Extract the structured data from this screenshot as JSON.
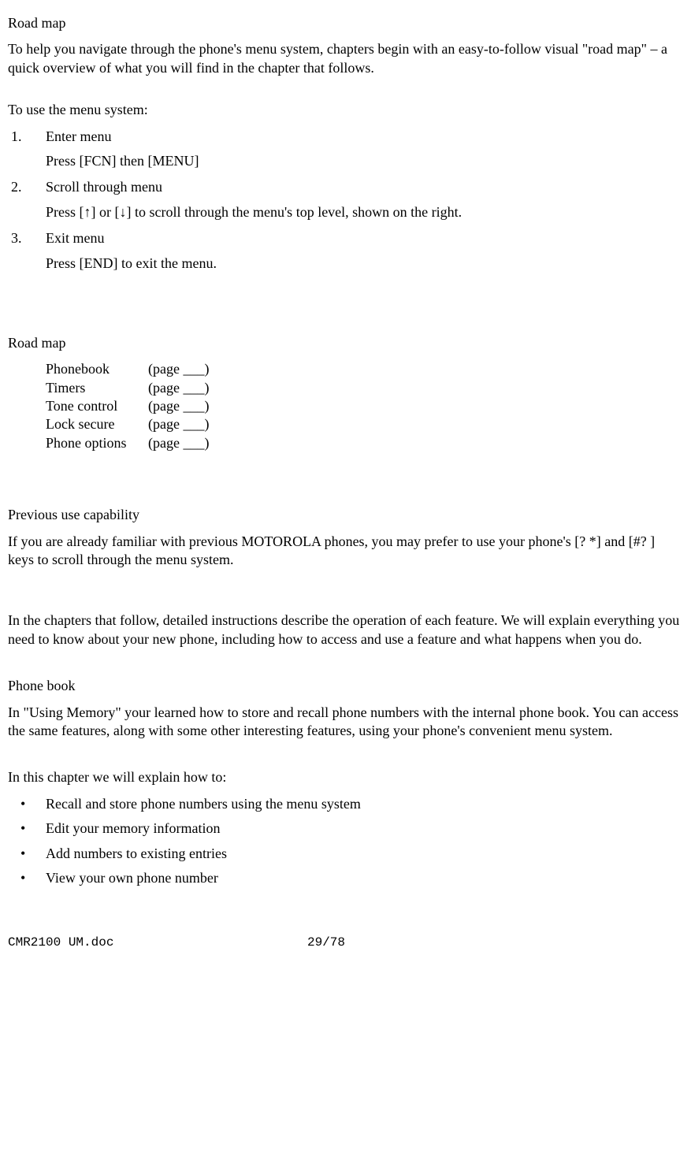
{
  "roadmap_title": "Road map",
  "roadmap_intro": "To help you navigate through the phone's menu system, chapters begin with an easy-to-follow visual \"road map\" – a quick overview of what you will find in the chapter that follows.",
  "menu_intro": "To use the menu system:",
  "steps": [
    {
      "title": "Enter menu",
      "body": "Press [FCN] then [MENU]"
    },
    {
      "title": "Scroll through menu",
      "body": "Press [↑] or [↓] to scroll through the menu's top level, shown on the right."
    },
    {
      "title": "Exit menu",
      "body": "Press [END] to exit the menu."
    }
  ],
  "roadmap2_title": "Road map",
  "roadmap_items": [
    {
      "label": "Phonebook",
      "page": "(page ___)"
    },
    {
      "label": "Timers",
      "page": "(page ___)"
    },
    {
      "label": "Tone control",
      "page": "(page ___)"
    },
    {
      "label": "Lock secure",
      "page": "(page ___)"
    },
    {
      "label": "Phone options",
      "page": "(page ___)"
    }
  ],
  "prev_title": "Previous use capability",
  "prev_body": "If you are already familiar with previous MOTOROLA phones, you may prefer to use your phone's [?  *] and [#?  ] keys to scroll through the menu system.",
  "chapters_body": "In the chapters that follow, detailed instructions describe the operation of each feature. We will explain everything you need to know about your new phone, including how to access and use a feature and what happens when you do.",
  "phonebook_title": "Phone book",
  "phonebook_body": "In \"Using Memory\" your learned how to store and recall phone numbers with the internal phone book. You can access the same features, along with some other interesting features, using your phone's convenient menu system.",
  "chapter_explain_intro": "In this chapter we will explain how to:",
  "bullets": [
    "Recall and store phone numbers using the menu system",
    "Edit your memory information",
    "Add numbers to existing entries",
    "View your own phone number"
  ],
  "footer": {
    "doc": "CMR2100 UM.doc",
    "page": "29/78"
  }
}
